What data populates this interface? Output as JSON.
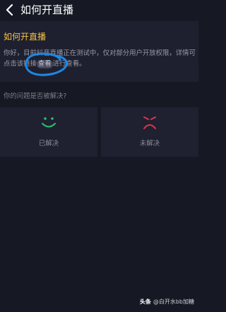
{
  "nav": {
    "title": "如何开直播",
    "back_icon": "chevron-left-icon"
  },
  "article": {
    "title": "如何开直播",
    "body_part1": "你好，目前抖音直播正在测试中，仅对部分用户开放权限，详情可点击该链接",
    "link_text": "查看",
    "body_part2": "进行查看。"
  },
  "feedback": {
    "question": "你的问题是否被解决?",
    "solved_label": "已解决",
    "unsolved_label": "未解决",
    "solved_icon": "smile-face-icon",
    "unsolved_icon": "sad-face-icon",
    "solved_color": "#2fbf71",
    "unsolved_color": "#e0354a"
  },
  "watermark": {
    "brand": "头条",
    "handle": "@白开水bb加糖"
  },
  "colors": {
    "background": "#161823",
    "panel": "#1e2030",
    "title_accent": "#f6c142",
    "annotation": "#1e88e5"
  }
}
